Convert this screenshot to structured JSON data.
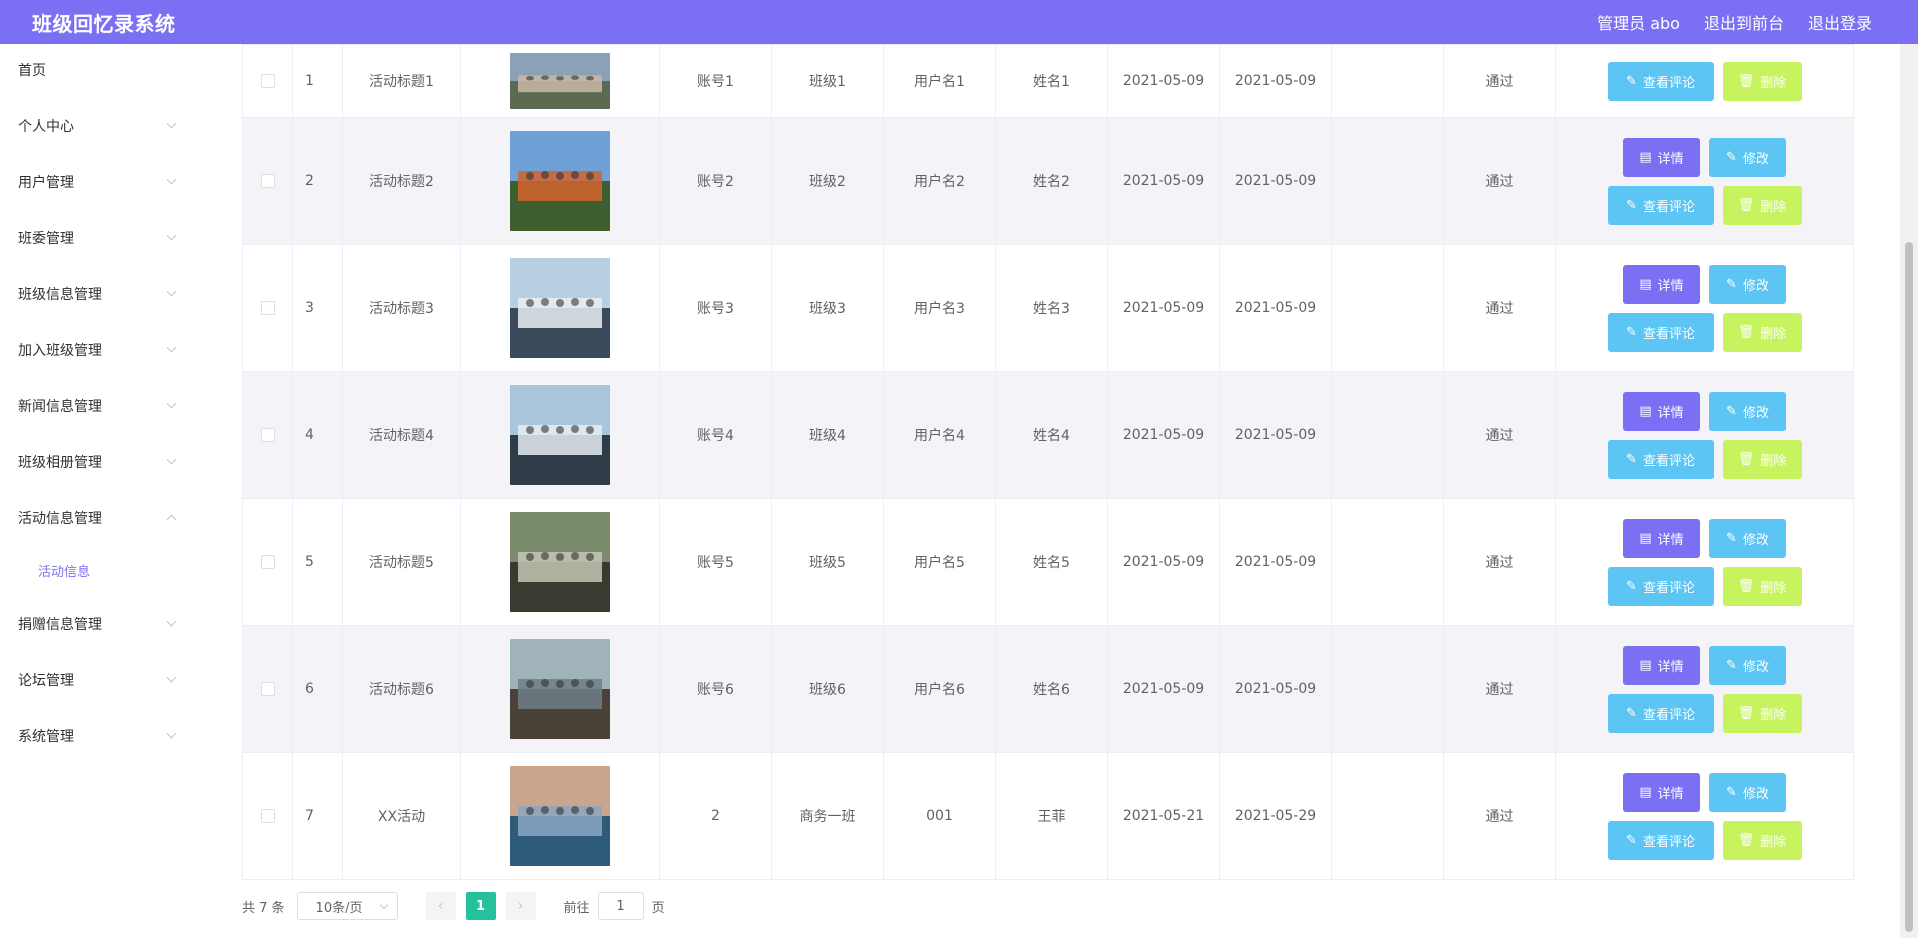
{
  "header": {
    "title": "班级回忆录系统",
    "admin": "管理员 abo",
    "front": "退出到前台",
    "logout": "退出登录"
  },
  "sidebar": {
    "items": [
      {
        "label": "首页"
      },
      {
        "label": "个人中心"
      },
      {
        "label": "用户管理"
      },
      {
        "label": "班委管理"
      },
      {
        "label": "班级信息管理"
      },
      {
        "label": "加入班级管理"
      },
      {
        "label": "新闻信息管理"
      },
      {
        "label": "班级相册管理"
      },
      {
        "label": "活动信息管理"
      },
      {
        "label": "捐赠信息管理"
      },
      {
        "label": "论坛管理"
      },
      {
        "label": "系统管理"
      }
    ],
    "sub_active": "活动信息"
  },
  "buttons": {
    "detail": "详情",
    "edit": "修改",
    "review": "查看评论",
    "delete": "删除"
  },
  "rows": [
    {
      "idx": "1",
      "title": "活动标题1",
      "account": "账号1",
      "class": "班级1",
      "username": "用户名1",
      "name": "姓名1",
      "start": "2021-05-09",
      "end": "2021-05-09",
      "note": "",
      "status": "通过"
    },
    {
      "idx": "2",
      "title": "活动标题2",
      "account": "账号2",
      "class": "班级2",
      "username": "用户名2",
      "name": "姓名2",
      "start": "2021-05-09",
      "end": "2021-05-09",
      "note": "",
      "status": "通过"
    },
    {
      "idx": "3",
      "title": "活动标题3",
      "account": "账号3",
      "class": "班级3",
      "username": "用户名3",
      "name": "姓名3",
      "start": "2021-05-09",
      "end": "2021-05-09",
      "note": "",
      "status": "通过"
    },
    {
      "idx": "4",
      "title": "活动标题4",
      "account": "账号4",
      "class": "班级4",
      "username": "用户名4",
      "name": "姓名4",
      "start": "2021-05-09",
      "end": "2021-05-09",
      "note": "",
      "status": "通过"
    },
    {
      "idx": "5",
      "title": "活动标题5",
      "account": "账号5",
      "class": "班级5",
      "username": "用户名5",
      "name": "姓名5",
      "start": "2021-05-09",
      "end": "2021-05-09",
      "note": "",
      "status": "通过"
    },
    {
      "idx": "6",
      "title": "活动标题6",
      "account": "账号6",
      "class": "班级6",
      "username": "用户名6",
      "name": "姓名6",
      "start": "2021-05-09",
      "end": "2021-05-09",
      "note": "",
      "status": "通过"
    },
    {
      "idx": "7",
      "title": "XX活动",
      "account": "2",
      "class": "商务一班",
      "username": "001",
      "name": "王菲",
      "start": "2021-05-21",
      "end": "2021-05-29",
      "note": "",
      "status": "通过"
    }
  ],
  "pagination": {
    "total": "共 7 条",
    "page_size": "10条/页",
    "current": "1",
    "goto_prefix": "前往",
    "goto_value": "1",
    "goto_suffix": "页"
  },
  "colors": {
    "header": "#7b70f3",
    "detail_btn": "#7b70f3",
    "edit_btn": "#5dc5f3",
    "delete_btn": "#c7f35f",
    "page_active": "#25c19d"
  }
}
